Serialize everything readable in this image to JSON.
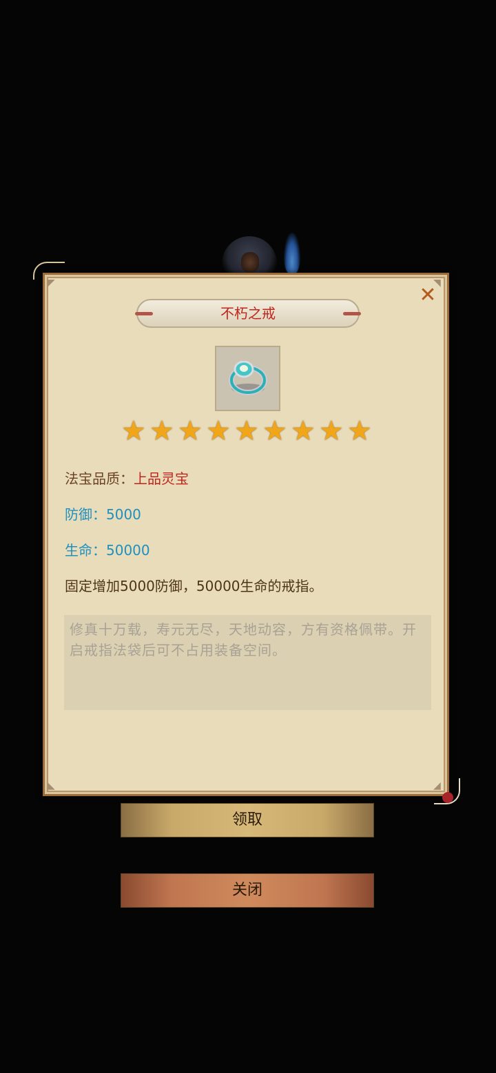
{
  "dialog": {
    "title": "不朽之戒",
    "item_icon": "ring-icon",
    "star_count": 9,
    "stars": [
      "★",
      "★",
      "★",
      "★",
      "★",
      "★",
      "★",
      "★",
      "★"
    ],
    "quality_label": "法宝品质：",
    "quality_value": "上品灵宝",
    "defense_label": "防御：5000",
    "life_label": "生命：50000",
    "effect_text": "固定增加5000防御，50000生命的戒指。",
    "lore_text": "修真十万载，寿元无尽，天地动容，方有资格佩带。开启戒指法袋后可不占用装备空间。",
    "close_icon": "✕"
  },
  "buttons": {
    "claim": "领取",
    "close": "关闭"
  },
  "colors": {
    "title_red": "#c0241c",
    "stat_blue": "#1f8fbd",
    "star_gold": "#f0a618",
    "panel_bg": "#e9dcbb"
  }
}
